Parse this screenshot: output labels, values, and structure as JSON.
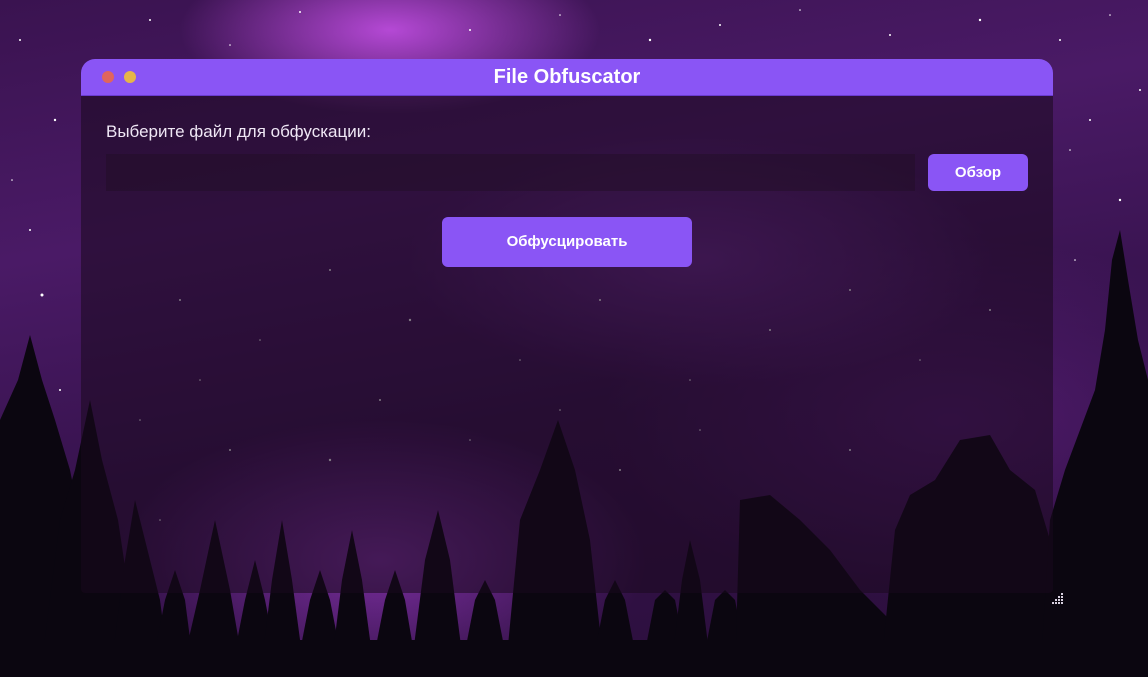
{
  "window": {
    "title": "File Obfuscator"
  },
  "main": {
    "prompt": "Выберите файл для обфускации:",
    "file_path_value": "",
    "browse_label": "Обзор",
    "obfuscate_label": "Обфусцировать"
  },
  "colors": {
    "accent": "#8a55f5",
    "traffic_close": "#e0655d",
    "traffic_minimize": "#e6b548"
  },
  "icons": {
    "close": "close-traffic-light-icon",
    "minimize": "minimize-traffic-light-icon",
    "resize": "resize-grip-icon"
  }
}
